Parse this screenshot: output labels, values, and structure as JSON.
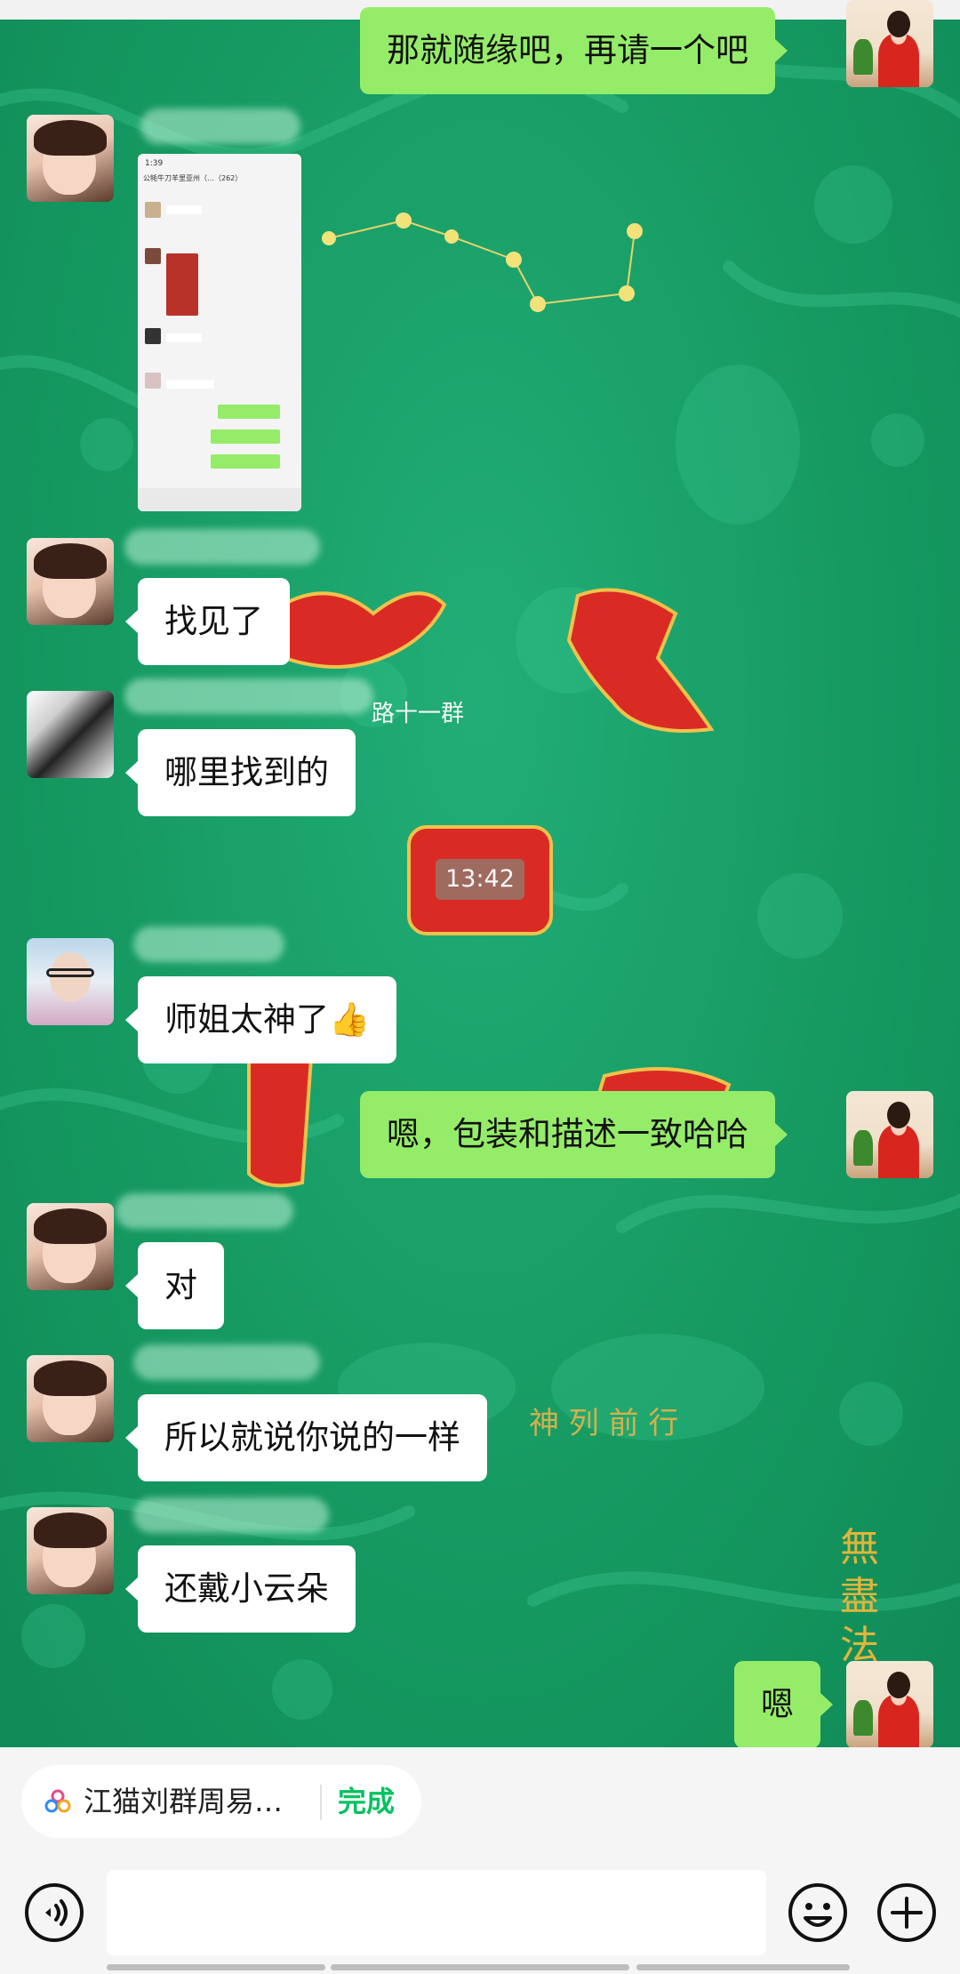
{
  "messages": [
    {
      "side": "out",
      "text": "那就随缘吧，再请一个吧"
    },
    {
      "side": "in",
      "type": "image",
      "image_caption": "公牦牛刀羊里亚州（…（262）",
      "image_time": "1:39"
    },
    {
      "side": "in",
      "text": "找见了"
    },
    {
      "side": "in",
      "text": "哪里找到的"
    },
    {
      "side": "in",
      "text": "师姐太神了👍"
    },
    {
      "side": "out",
      "text": "嗯，包装和描述一致哈哈"
    },
    {
      "side": "in",
      "text": "对"
    },
    {
      "side": "in",
      "text": "所以就说你说的一样"
    },
    {
      "side": "in",
      "text": "还戴小云朵"
    },
    {
      "side": "out",
      "text": "嗯"
    }
  ],
  "system": {
    "group_fragment": "路十一群",
    "timestamp": "13:42"
  },
  "background_text": {
    "motto": "神 列 前 行",
    "seal": "無 盡 法"
  },
  "shortcut_chip": {
    "title": "江猫刘群周易…",
    "action": "完成"
  },
  "colors": {
    "bubble_out": "#95ec69",
    "bubble_in": "#ffffff",
    "background": "#1aa06a",
    "accent_done": "#07c160"
  },
  "icons": [
    "voice-icon",
    "emoji-icon",
    "plus-icon",
    "cloud-icon"
  ]
}
